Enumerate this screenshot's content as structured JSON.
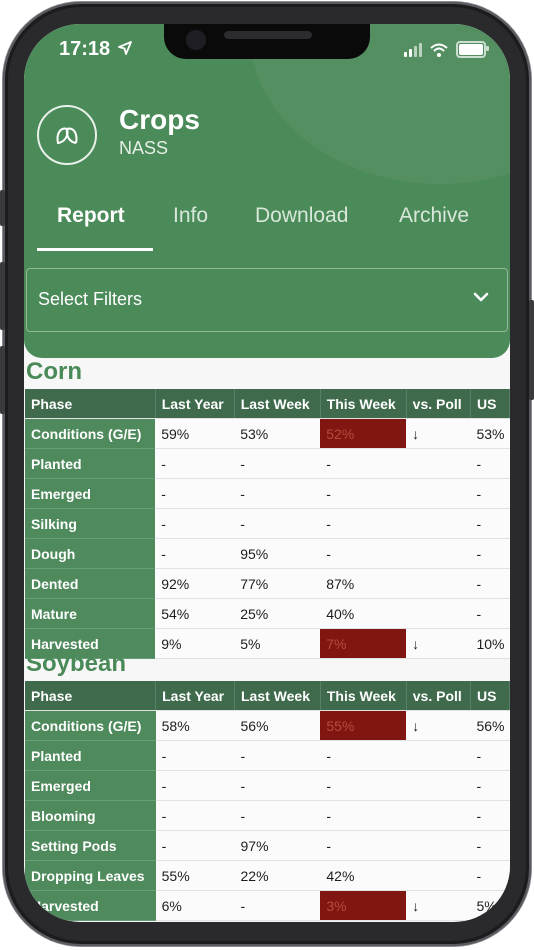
{
  "status_bar": {
    "time": "17:18",
    "location_icon": "location-arrow-icon",
    "signal_icon": "cellular-signal-icon",
    "wifi_icon": "wifi-icon",
    "battery_icon": "battery-icon"
  },
  "app": {
    "title": "Crops",
    "subtitle": "NASS",
    "logo_icon": "leaf-icon",
    "brand_color": "#4b8a59",
    "highlight_color": "#7f1612"
  },
  "tabs": [
    {
      "label": "Report",
      "active": true
    },
    {
      "label": "Info",
      "active": false
    },
    {
      "label": "Download",
      "active": false
    },
    {
      "label": "Archive",
      "active": false
    }
  ],
  "filter": {
    "label": "Select Filters",
    "icon": "chevron-down-icon"
  },
  "columns": [
    "Phase",
    "Last Year",
    "Last Week",
    "This Week",
    "vs. Poll",
    "US"
  ],
  "sections": [
    {
      "title": "Corn",
      "rows": [
        {
          "phase": "Conditions (G/E)",
          "last_year": "59%",
          "last_week": "53%",
          "this_week": "52%",
          "vs_poll": "↓",
          "us": "53%",
          "highlight": true
        },
        {
          "phase": "Planted",
          "last_year": "-",
          "last_week": "-",
          "this_week": "-",
          "vs_poll": "",
          "us": "-",
          "highlight": false
        },
        {
          "phase": "Emerged",
          "last_year": "-",
          "last_week": "-",
          "this_week": "-",
          "vs_poll": "",
          "us": "-",
          "highlight": false
        },
        {
          "phase": "Silking",
          "last_year": "-",
          "last_week": "-",
          "this_week": "-",
          "vs_poll": "",
          "us": "-",
          "highlight": false
        },
        {
          "phase": "Dough",
          "last_year": "-",
          "last_week": "95%",
          "this_week": "-",
          "vs_poll": "",
          "us": "-",
          "highlight": false
        },
        {
          "phase": "Dented",
          "last_year": "92%",
          "last_week": "77%",
          "this_week": "87%",
          "vs_poll": "",
          "us": "-",
          "highlight": false
        },
        {
          "phase": "Mature",
          "last_year": "54%",
          "last_week": "25%",
          "this_week": "40%",
          "vs_poll": "",
          "us": "-",
          "highlight": false
        },
        {
          "phase": "Harvested",
          "last_year": "9%",
          "last_week": "5%",
          "this_week": "7%",
          "vs_poll": "↓",
          "us": "10%",
          "highlight": true
        }
      ]
    },
    {
      "title": "Soybean",
      "rows": [
        {
          "phase": "Conditions (G/E)",
          "last_year": "58%",
          "last_week": "56%",
          "this_week": "55%",
          "vs_poll": "↓",
          "us": "56%",
          "highlight": true
        },
        {
          "phase": "Planted",
          "last_year": "-",
          "last_week": "-",
          "this_week": "-",
          "vs_poll": "",
          "us": "-",
          "highlight": false
        },
        {
          "phase": "Emerged",
          "last_year": "-",
          "last_week": "-",
          "this_week": "-",
          "vs_poll": "",
          "us": "-",
          "highlight": false
        },
        {
          "phase": "Blooming",
          "last_year": "-",
          "last_week": "-",
          "this_week": "-",
          "vs_poll": "",
          "us": "-",
          "highlight": false
        },
        {
          "phase": "Setting Pods",
          "last_year": "-",
          "last_week": "97%",
          "this_week": "-",
          "vs_poll": "",
          "us": "-",
          "highlight": false
        },
        {
          "phase": "Dropping Leaves",
          "last_year": "55%",
          "last_week": "22%",
          "this_week": "42%",
          "vs_poll": "",
          "us": "-",
          "highlight": false
        },
        {
          "phase": "Harvested",
          "last_year": "6%",
          "last_week": "-",
          "this_week": "3%",
          "vs_poll": "↓",
          "us": "5%",
          "highlight": true
        }
      ]
    }
  ]
}
